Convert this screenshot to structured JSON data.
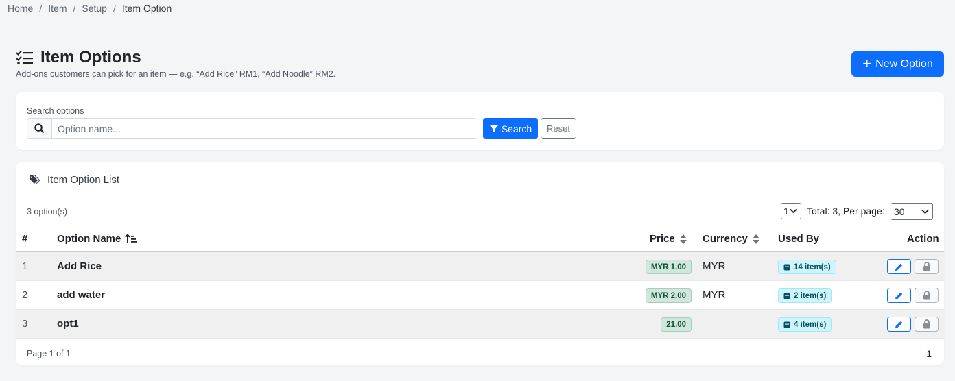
{
  "breadcrumb": {
    "items": [
      "Home",
      "Item",
      "Setup"
    ],
    "current": "Item Option",
    "separator": "/"
  },
  "header": {
    "title": "Item Options",
    "subtitle": "Add-ons customers can pick for an item — e.g. “Add Rice” RM1, “Add Noodle” RM2.",
    "new_button": "New Option",
    "title_icon": "list-check-icon"
  },
  "search": {
    "label": "Search options",
    "placeholder": "Option name...",
    "value": "",
    "search_button": "Search",
    "reset_button": "Reset"
  },
  "list": {
    "title": "Item Option List",
    "count_text": "3 option(s)",
    "page_select": "1",
    "total_text": "Total: 3, Per page:",
    "per_page": "30",
    "columns": {
      "index": "#",
      "name": "Option Name",
      "price": "Price",
      "currency": "Currency",
      "used_by": "Used By",
      "action": "Action"
    },
    "rows": [
      {
        "index": "1",
        "name": "Add Rice",
        "price": "MYR 1.00",
        "currency": "MYR",
        "used_by": "14 item(s)"
      },
      {
        "index": "2",
        "name": "add water",
        "price": "MYR 2.00",
        "currency": "MYR",
        "used_by": "2 item(s)"
      },
      {
        "index": "3",
        "name": "opt1",
        "price": "21.00",
        "currency": "",
        "used_by": "4 item(s)"
      }
    ],
    "page_info": "Page 1 of 1",
    "page_number": "1"
  },
  "colors": {
    "primary": "#0d6efd",
    "price_badge_bg": "#d1e7dd",
    "used_badge_bg": "#cff4fc",
    "page_bg": "#f4f5f7"
  }
}
